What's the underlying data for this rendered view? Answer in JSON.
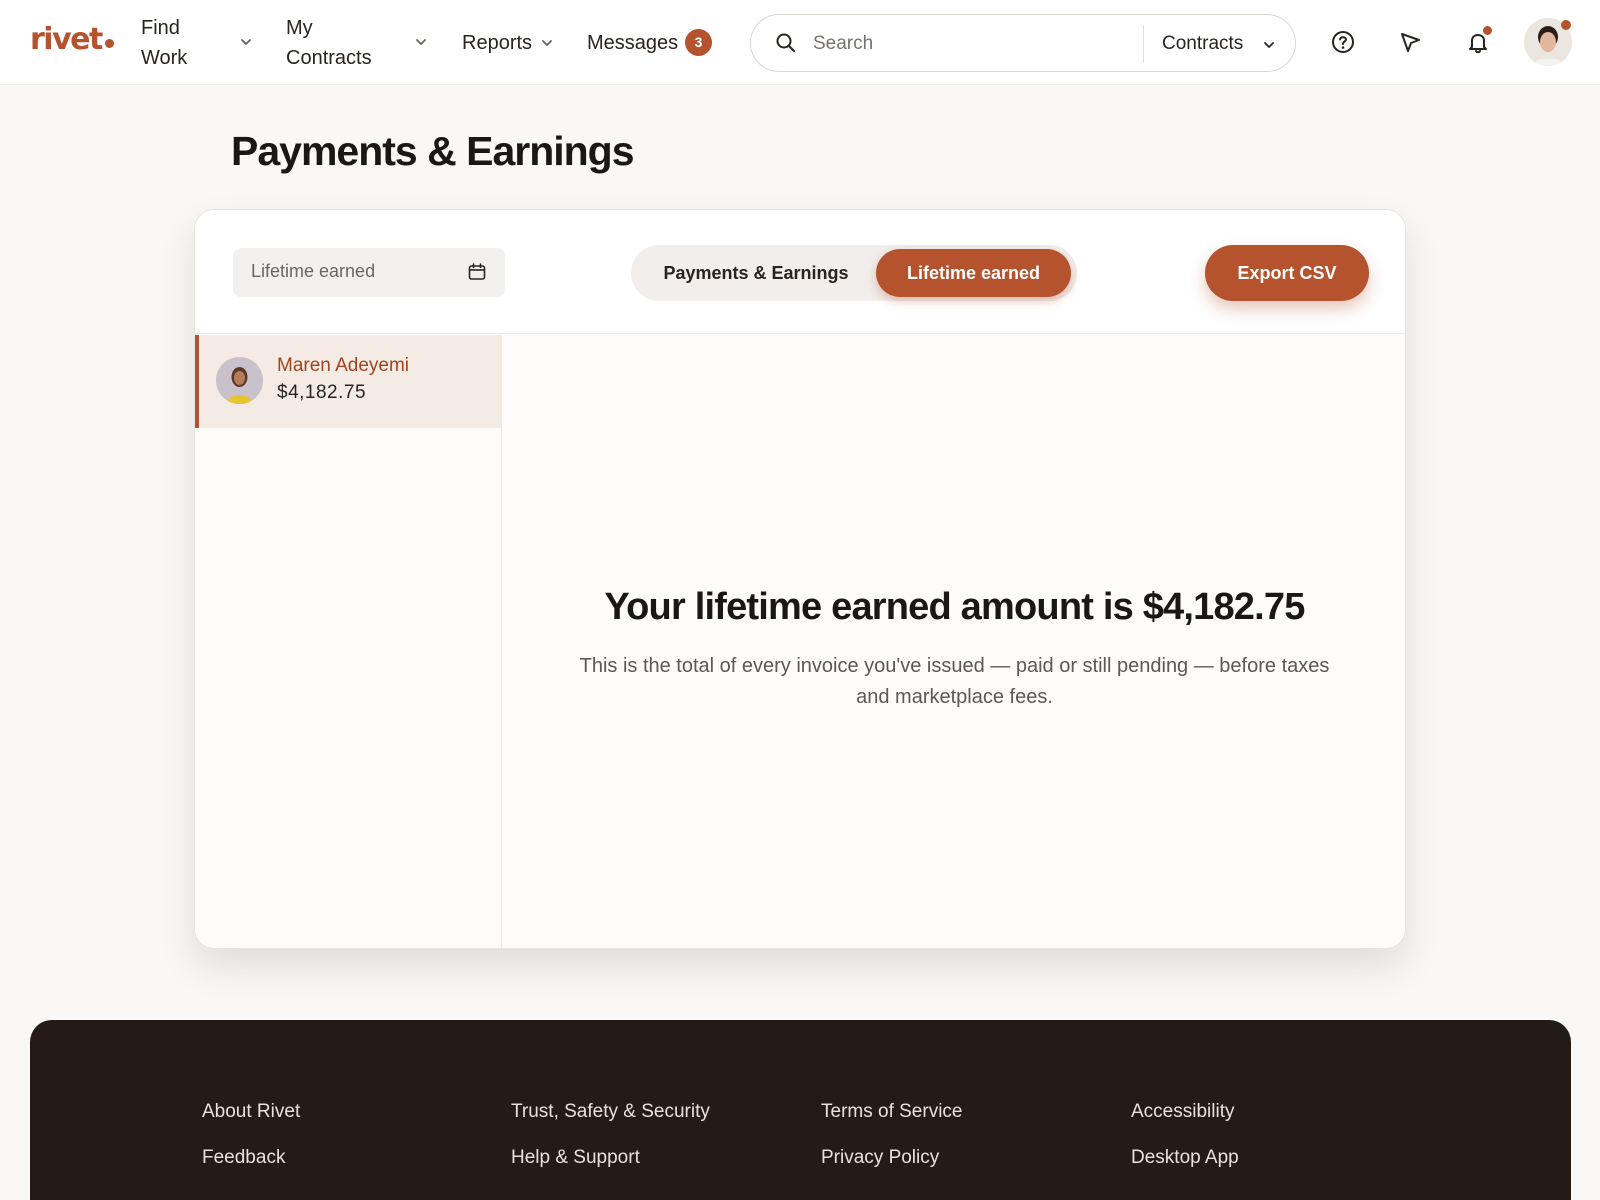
{
  "header": {
    "logo": "rivet",
    "nav": {
      "find_work_line1": "Find",
      "find_work_line2": "Work",
      "my_contracts_line1": "My",
      "my_contracts_line2": "Contracts",
      "reports": "Reports",
      "messages": "Messages",
      "messages_count": "3"
    },
    "search": {
      "placeholder": "Search",
      "scope": "Contracts"
    },
    "icons": [
      "help-icon",
      "send-icon",
      "bell-icon",
      "avatar"
    ]
  },
  "page": {
    "title": "Payments & Earnings"
  },
  "card": {
    "date_field_label": "Lifetime earned",
    "toggle": {
      "option1": "Payments & Earnings",
      "option2": "Lifetime earned",
      "active": "option2"
    },
    "export_label": "Export CSV",
    "sidebar": {
      "items": [
        {
          "name": "Maren Adeyemi",
          "amount": "$4,182.75"
        }
      ]
    },
    "main": {
      "headline": "Your lifetime earned amount is $4,182.75",
      "subtext": "This is the total of every invoice you've issued — paid or still pending — before taxes and marketplace fees."
    }
  },
  "footer": {
    "columns": [
      [
        "About Rivet",
        "Feedback"
      ],
      [
        "Trust, Safety & Security",
        "Help & Support"
      ],
      [
        "Terms of Service",
        "Privacy Policy"
      ],
      [
        "Accessibility",
        "Desktop App"
      ]
    ]
  },
  "colors": {
    "accent": "#b4532e",
    "footer_bg": "#241a16",
    "page_bg": "#f9f8f7"
  }
}
